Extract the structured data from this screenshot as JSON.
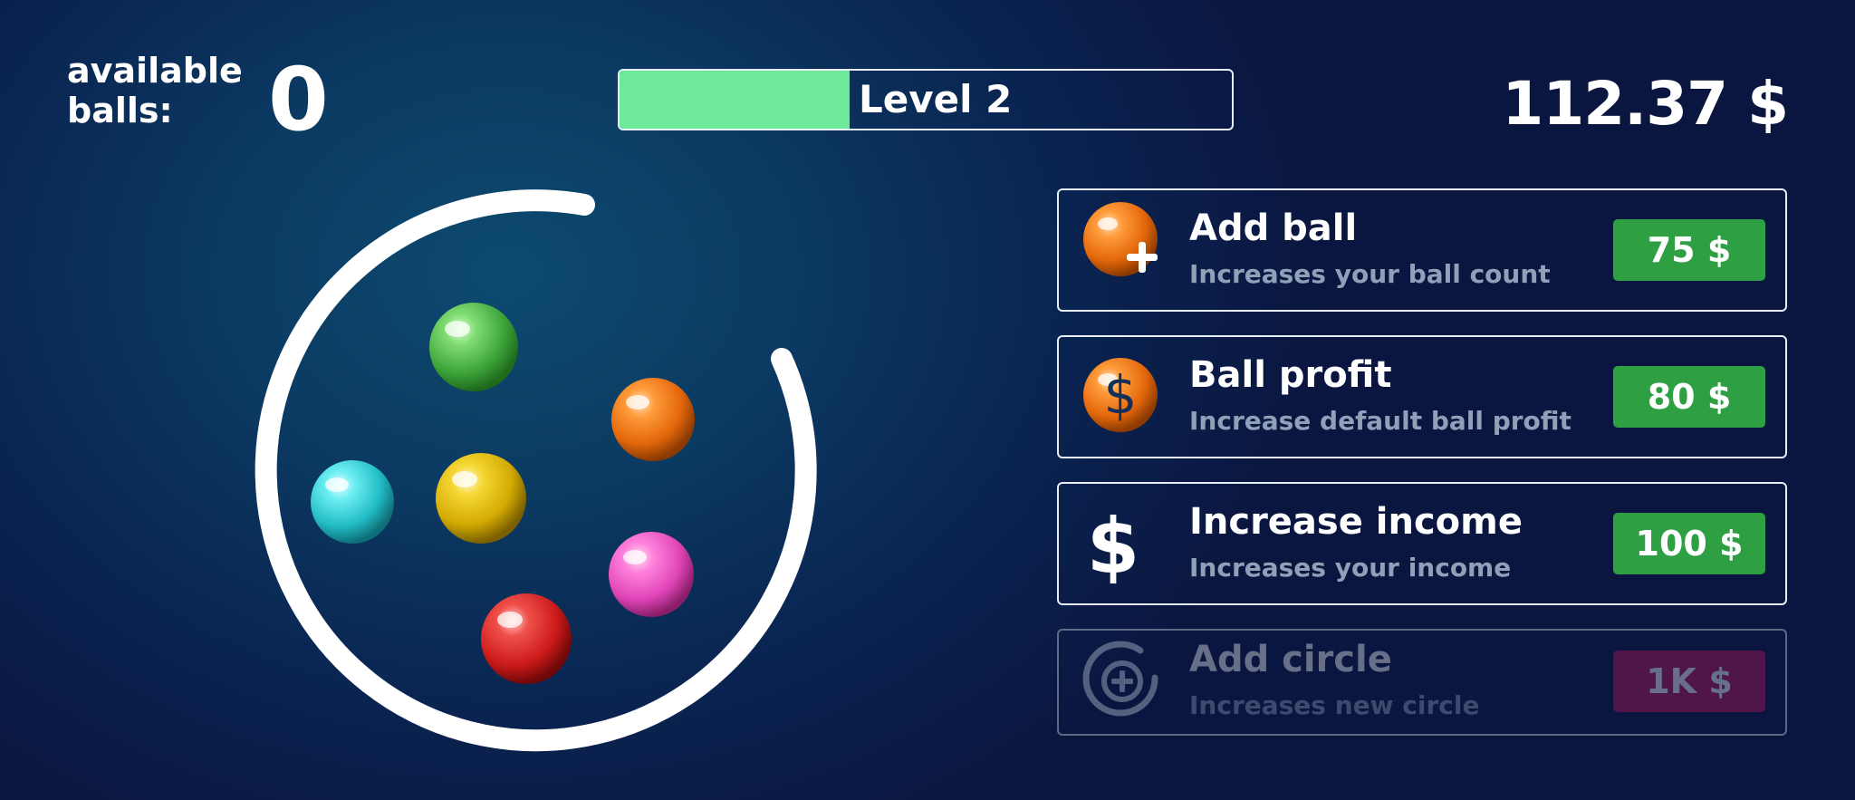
{
  "hud": {
    "available_label": "available balls:",
    "available_count": "0",
    "level_label": "Level 2",
    "level_progress": 0.375,
    "money": "112.37 $"
  },
  "game": {
    "balls": [
      {
        "name": "green-ball",
        "color": "#5cc55a"
      },
      {
        "name": "orange-ball",
        "color": "#f07a12"
      },
      {
        "name": "cyan-ball",
        "color": "#3ad8df"
      },
      {
        "name": "yellow-ball",
        "color": "#e8c20a"
      },
      {
        "name": "pink-ball",
        "color": "#f05ac8"
      },
      {
        "name": "red-ball",
        "color": "#e02828"
      }
    ]
  },
  "upgrades": [
    {
      "icon": "add-ball-icon",
      "title": "Add ball",
      "desc": "Increases your ball count",
      "price": "75 $",
      "enabled": true
    },
    {
      "icon": "ball-profit-icon",
      "title": "Ball profit",
      "desc": "Increase default ball profit",
      "price": "80 $",
      "enabled": true
    },
    {
      "icon": "dollar-icon",
      "title": "Increase income",
      "desc": "Increases your income",
      "price": "100 $",
      "enabled": true
    },
    {
      "icon": "add-circle-icon",
      "title": "Add circle",
      "desc": "Increases new circle",
      "price": "1K $",
      "enabled": false
    }
  ],
  "colors": {
    "price_button": "#2ea043",
    "price_button_disabled": "#c2185b",
    "level_fill": "#6ee99a"
  }
}
